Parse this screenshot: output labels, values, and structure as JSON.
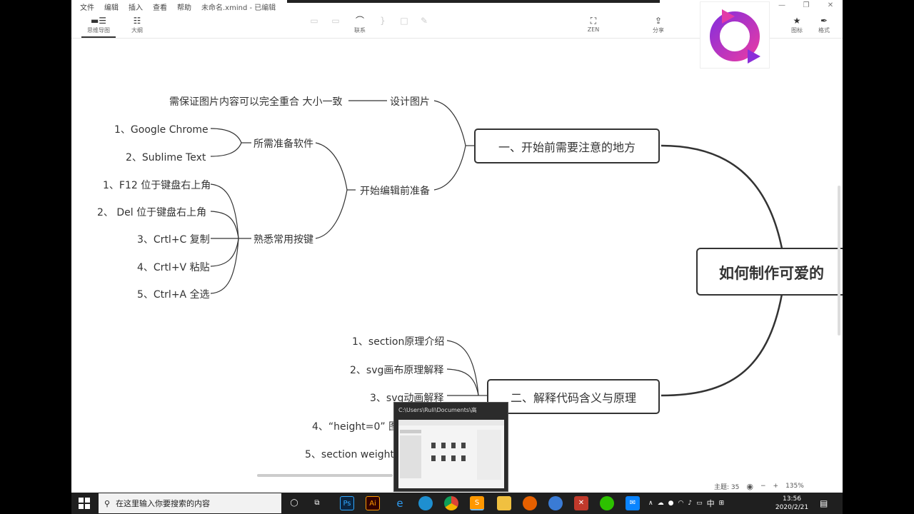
{
  "menu": {
    "items": [
      "文件",
      "编辑",
      "插入",
      "查看",
      "帮助"
    ],
    "doc_title": "未命名.xmind - 已编辑"
  },
  "toolbar": {
    "mindmap": "思维导图",
    "outline": "大纲",
    "relation": "联系",
    "zen": "ZEN",
    "share": "分享",
    "icon_panel": "图标",
    "format_panel": "格式"
  },
  "mindmap": {
    "root": "如何制作可爱的",
    "branch1": "一、开始前需要注意的地方",
    "design_image": "设计图片",
    "design_note": "需保证图片内容可以完全重合 大小一致",
    "prep_before_edit": "开始编辑前准备",
    "software": "所需准备软件",
    "software_items": [
      "1、Google Chrome",
      "2、Sublime Text"
    ],
    "keys": "熟悉常用按键",
    "key_items": [
      "1、F12 位于键盘右上角",
      "2、 Del 位于键盘右上角",
      "3、Crtl+C 复制",
      "4、Crtl+V 粘贴",
      "5、Ctrl+A 全选"
    ],
    "branch2": "二、解释代码含义与原理",
    "code_items": [
      "1、section原理介绍",
      "2、svg画布原理解释",
      "3、svg动画解释",
      "4、“height=0” 图",
      "5、section weight"
    ]
  },
  "status": {
    "topics": "主题: 35",
    "zoom": "135%"
  },
  "preview": {
    "title": "C:\\Users\\Ruli\\Documents\\高"
  },
  "taskbar": {
    "search_placeholder": "在这里输入你要搜索的内容",
    "time": "13:56",
    "date": "2020/2/21",
    "ime": "中"
  },
  "colors": {
    "line": "#333333",
    "logo_purple": "#8b2fd9",
    "logo_pink": "#e23aa8",
    "taskbar": "#1f1f1f"
  }
}
